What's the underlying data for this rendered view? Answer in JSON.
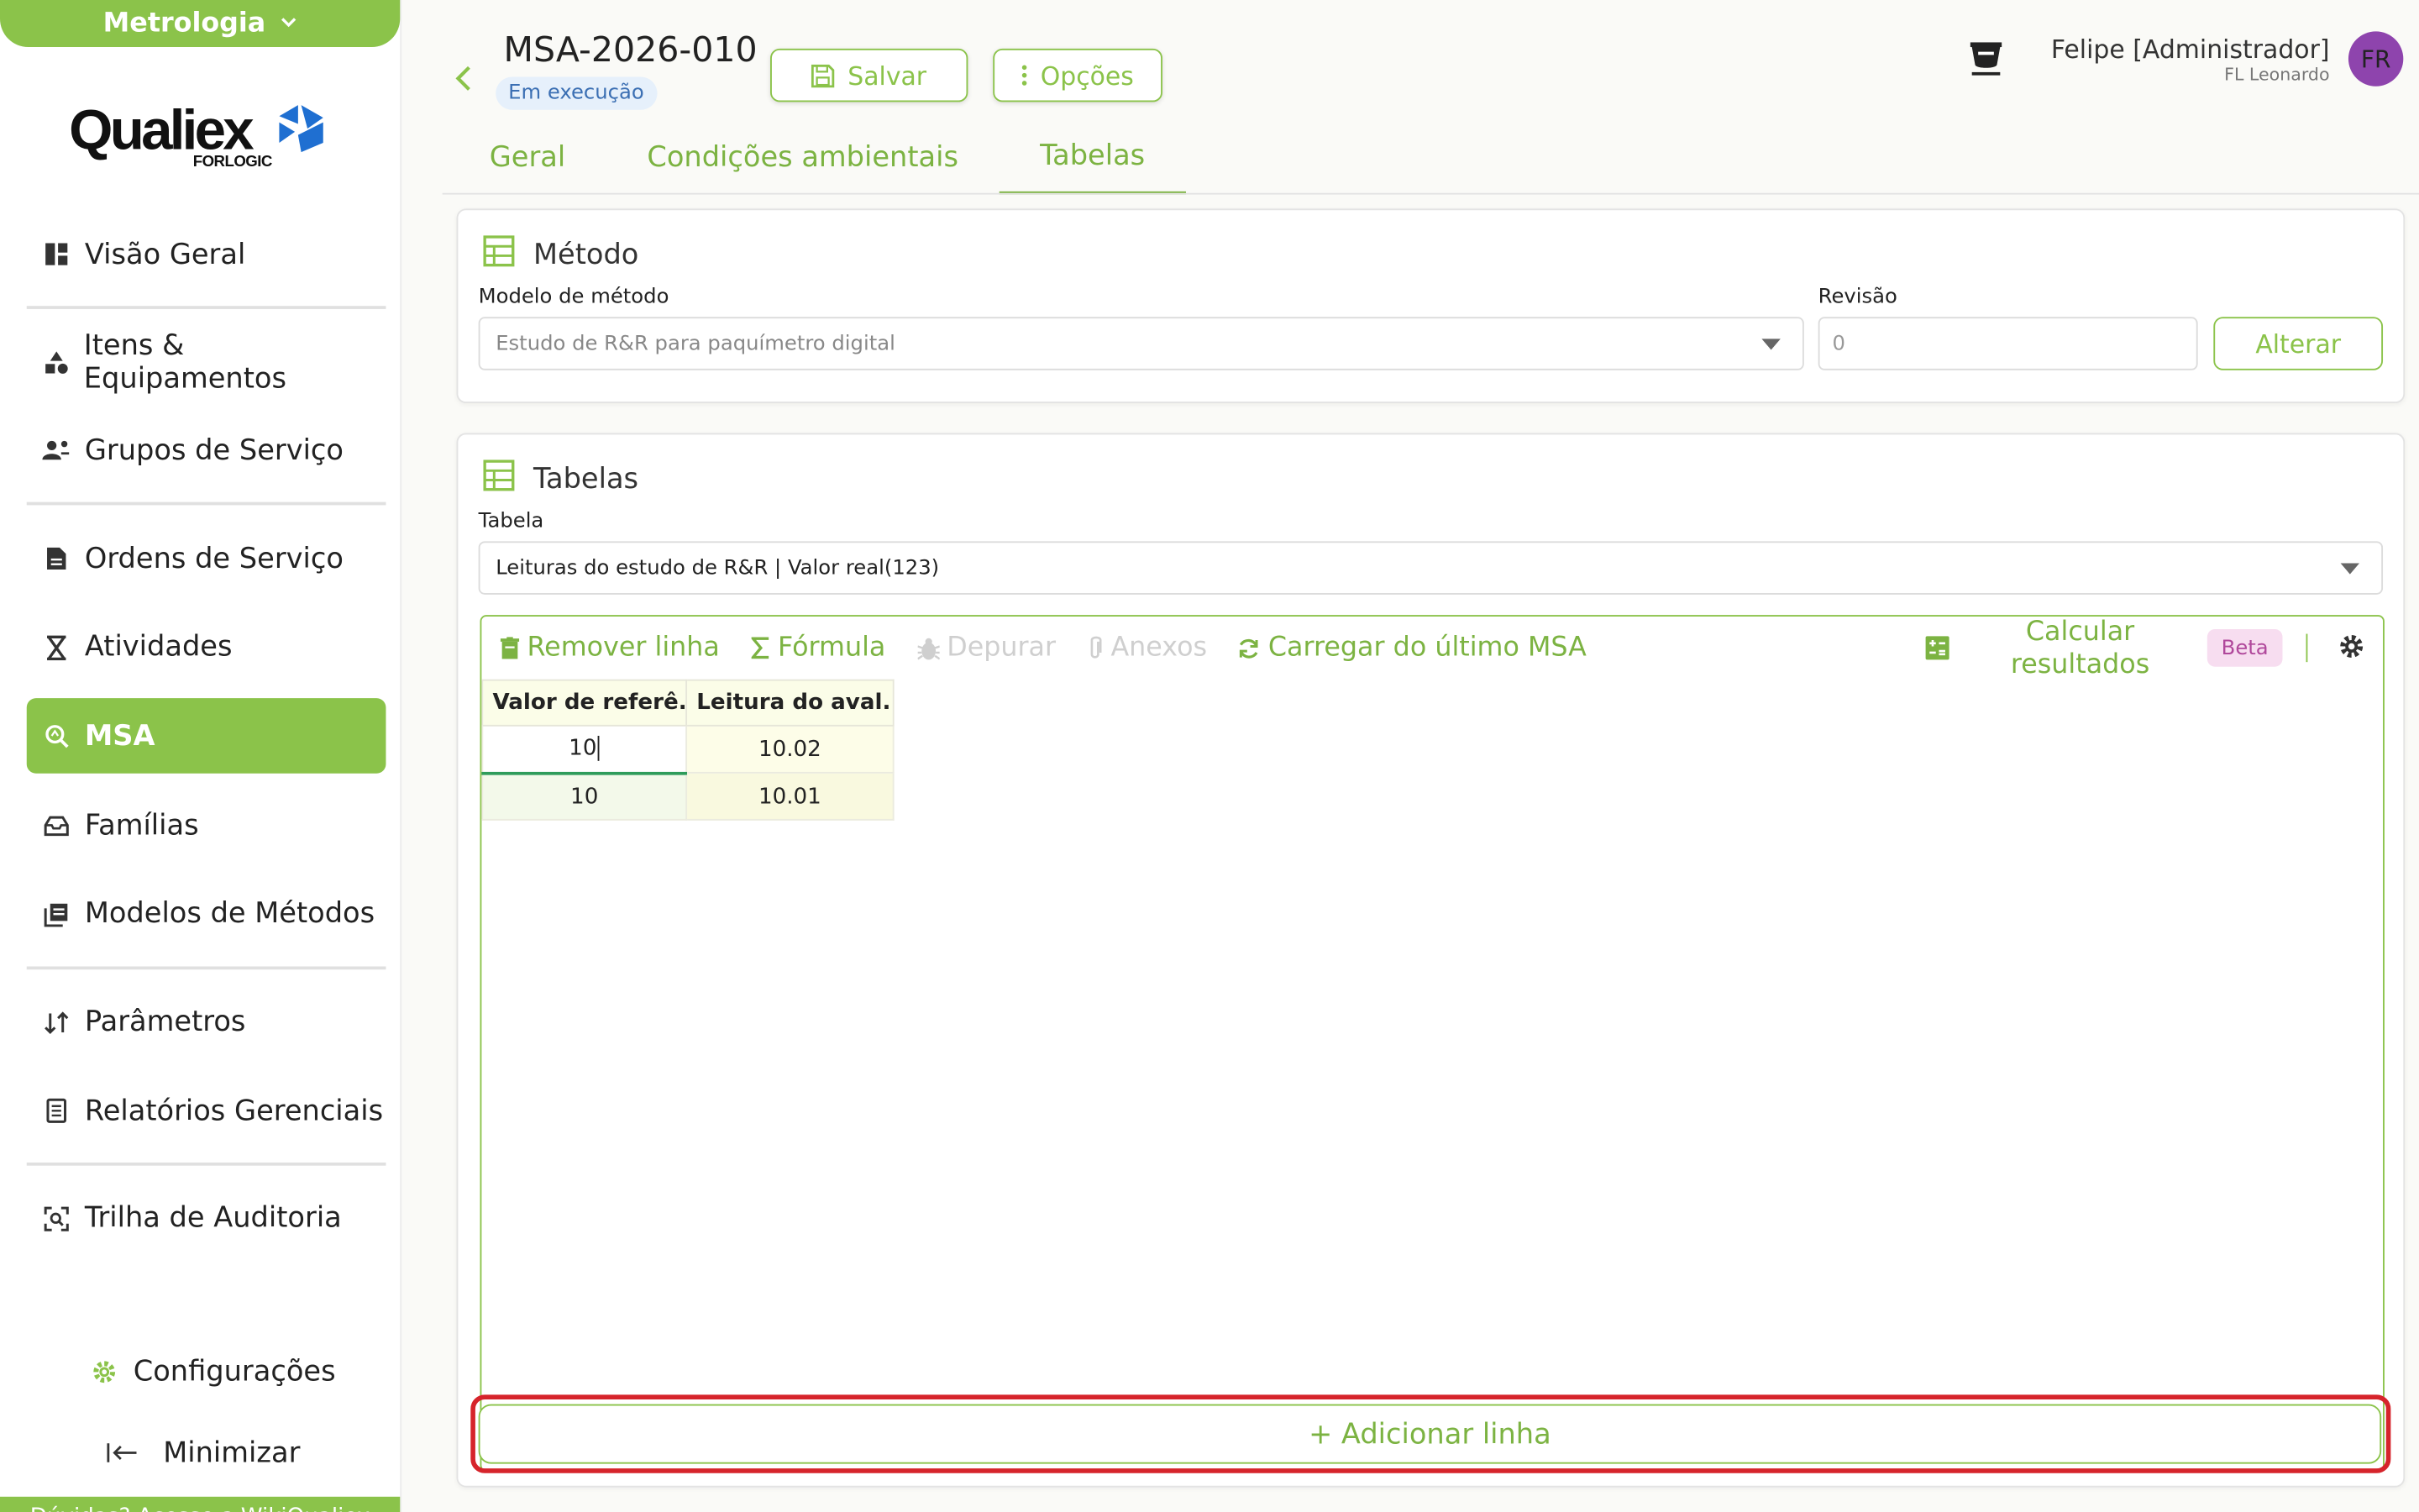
{
  "sidebar": {
    "module_label": "Metrologia",
    "logo_text": "Qualiex",
    "logo_sub": "FORLOGIC",
    "items": [
      {
        "label": "Visão Geral",
        "icon": "dashboard-icon"
      },
      {
        "label": "Itens & Equipamentos",
        "icon": "shapes-icon"
      },
      {
        "label": "Grupos de Serviço",
        "icon": "user-group-icon"
      },
      {
        "label": "Ordens de Serviço",
        "icon": "document-icon"
      },
      {
        "label": "Atividades",
        "icon": "hourglass-icon"
      },
      {
        "label": "MSA",
        "icon": "msa-search-icon"
      },
      {
        "label": "Famílias",
        "icon": "tray-icon"
      },
      {
        "label": "Modelos de Métodos",
        "icon": "library-icon"
      },
      {
        "label": "Parâmetros",
        "icon": "sort-icon"
      },
      {
        "label": "Relatórios Gerenciais",
        "icon": "report-icon"
      },
      {
        "label": "Trilha de Auditoria",
        "icon": "audit-icon"
      }
    ],
    "settings_label": "Configurações",
    "minimize_label": "Minimizar",
    "help_text": "Dúvidas? Acesse a",
    "help_link": "WikiQualiex"
  },
  "header": {
    "title": "MSA-2026-010",
    "status": "Em execução",
    "save_label": "Salvar",
    "options_label": "Opções",
    "tabs": [
      {
        "label": "Geral"
      },
      {
        "label": "Condições ambientais"
      },
      {
        "label": "Tabelas"
      }
    ],
    "user_name": "Felipe [Administrador]",
    "user_org": "FL Leonardo",
    "avatar_initials": "FR"
  },
  "method_card": {
    "title": "Método",
    "model_label": "Modelo de método",
    "model_value": "Estudo de R&R para paquímetro digital",
    "revision_label": "Revisão",
    "revision_placeholder": "0",
    "change_label": "Alterar"
  },
  "tables_card": {
    "title": "Tabelas",
    "table_label": "Tabela",
    "table_value": "Leituras do estudo de R&R | Valor real(123)",
    "toolbar": {
      "remove_row": "Remover linha",
      "formula": "Fórmula",
      "debug": "Depurar",
      "attachments": "Anexos",
      "load_last": "Carregar do último MSA",
      "calc_line1": "Calcular",
      "calc_line2": "resultados",
      "beta": "Beta"
    },
    "columns": [
      "Valor de referê...",
      "Leitura do aval..."
    ],
    "rows": [
      [
        "10",
        "10.02"
      ],
      [
        "10",
        "10.01"
      ]
    ],
    "add_row_label": "+ Adicionar linha"
  },
  "colors": {
    "accent": "#8bc34a",
    "accent_text": "#7cb342",
    "highlight": "#d6242b",
    "avatar": "#8e44ad"
  }
}
